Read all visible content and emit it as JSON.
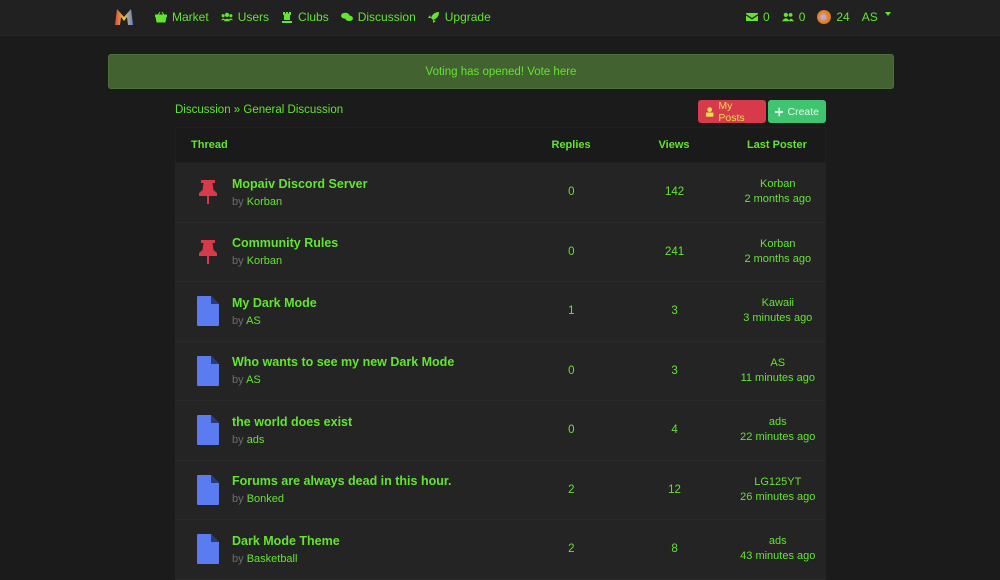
{
  "nav": {
    "logo": "M",
    "items": [
      {
        "label": "Market",
        "icon": "basket-icon"
      },
      {
        "label": "Users",
        "icon": "users-icon"
      },
      {
        "label": "Clubs",
        "icon": "chess-rook-icon"
      },
      {
        "label": "Discussion",
        "icon": "comments-icon"
      },
      {
        "label": "Upgrade",
        "icon": "rocket-icon"
      }
    ],
    "messages_count": "0",
    "friends_count": "0",
    "coins": "24",
    "user": "AS"
  },
  "alert": {
    "text": "Voting has opened! Vote here"
  },
  "breadcrumb": {
    "parent": "Discussion",
    "separator": " » ",
    "current": "General Discussion"
  },
  "actions": {
    "my_posts": "My Posts",
    "create": "Create"
  },
  "table": {
    "headers": {
      "thread": "Thread",
      "replies": "Replies",
      "views": "Views",
      "last_poster": "Last Poster"
    },
    "by_label": "by",
    "rows": [
      {
        "type": "pinned",
        "title": "Mopaiv Discord Server",
        "author": "Korban",
        "replies": "0",
        "views": "142",
        "last_poster": "Korban",
        "last_time": "2 months ago"
      },
      {
        "type": "pinned",
        "title": "Community Rules",
        "author": "Korban",
        "replies": "0",
        "views": "241",
        "last_poster": "Korban",
        "last_time": "2 months ago"
      },
      {
        "type": "file",
        "title": "My Dark Mode",
        "author": "AS",
        "replies": "1",
        "views": "3",
        "last_poster": "Kawaii",
        "last_time": "3 minutes ago"
      },
      {
        "type": "file",
        "title": "Who wants to see my new Dark Mode",
        "author": "AS",
        "replies": "0",
        "views": "3",
        "last_poster": "AS",
        "last_time": "11 minutes ago"
      },
      {
        "type": "file",
        "title": "the world does exist",
        "author": "ads",
        "replies": "0",
        "views": "4",
        "last_poster": "ads",
        "last_time": "22 minutes ago"
      },
      {
        "type": "file",
        "title": "Forums are always dead in this hour.",
        "author": "Bonked",
        "replies": "2",
        "views": "12",
        "last_poster": "LG125YT",
        "last_time": "26 minutes ago"
      },
      {
        "type": "file",
        "title": "Dark Mode Theme",
        "author": "Basketball",
        "replies": "2",
        "views": "8",
        "last_poster": "ads",
        "last_time": "43 minutes ago"
      }
    ]
  },
  "colors": {
    "accent": "#62e52d",
    "pin": "#d73a4a",
    "file": "#5b7cf0",
    "alert_bg": "#42622f"
  }
}
